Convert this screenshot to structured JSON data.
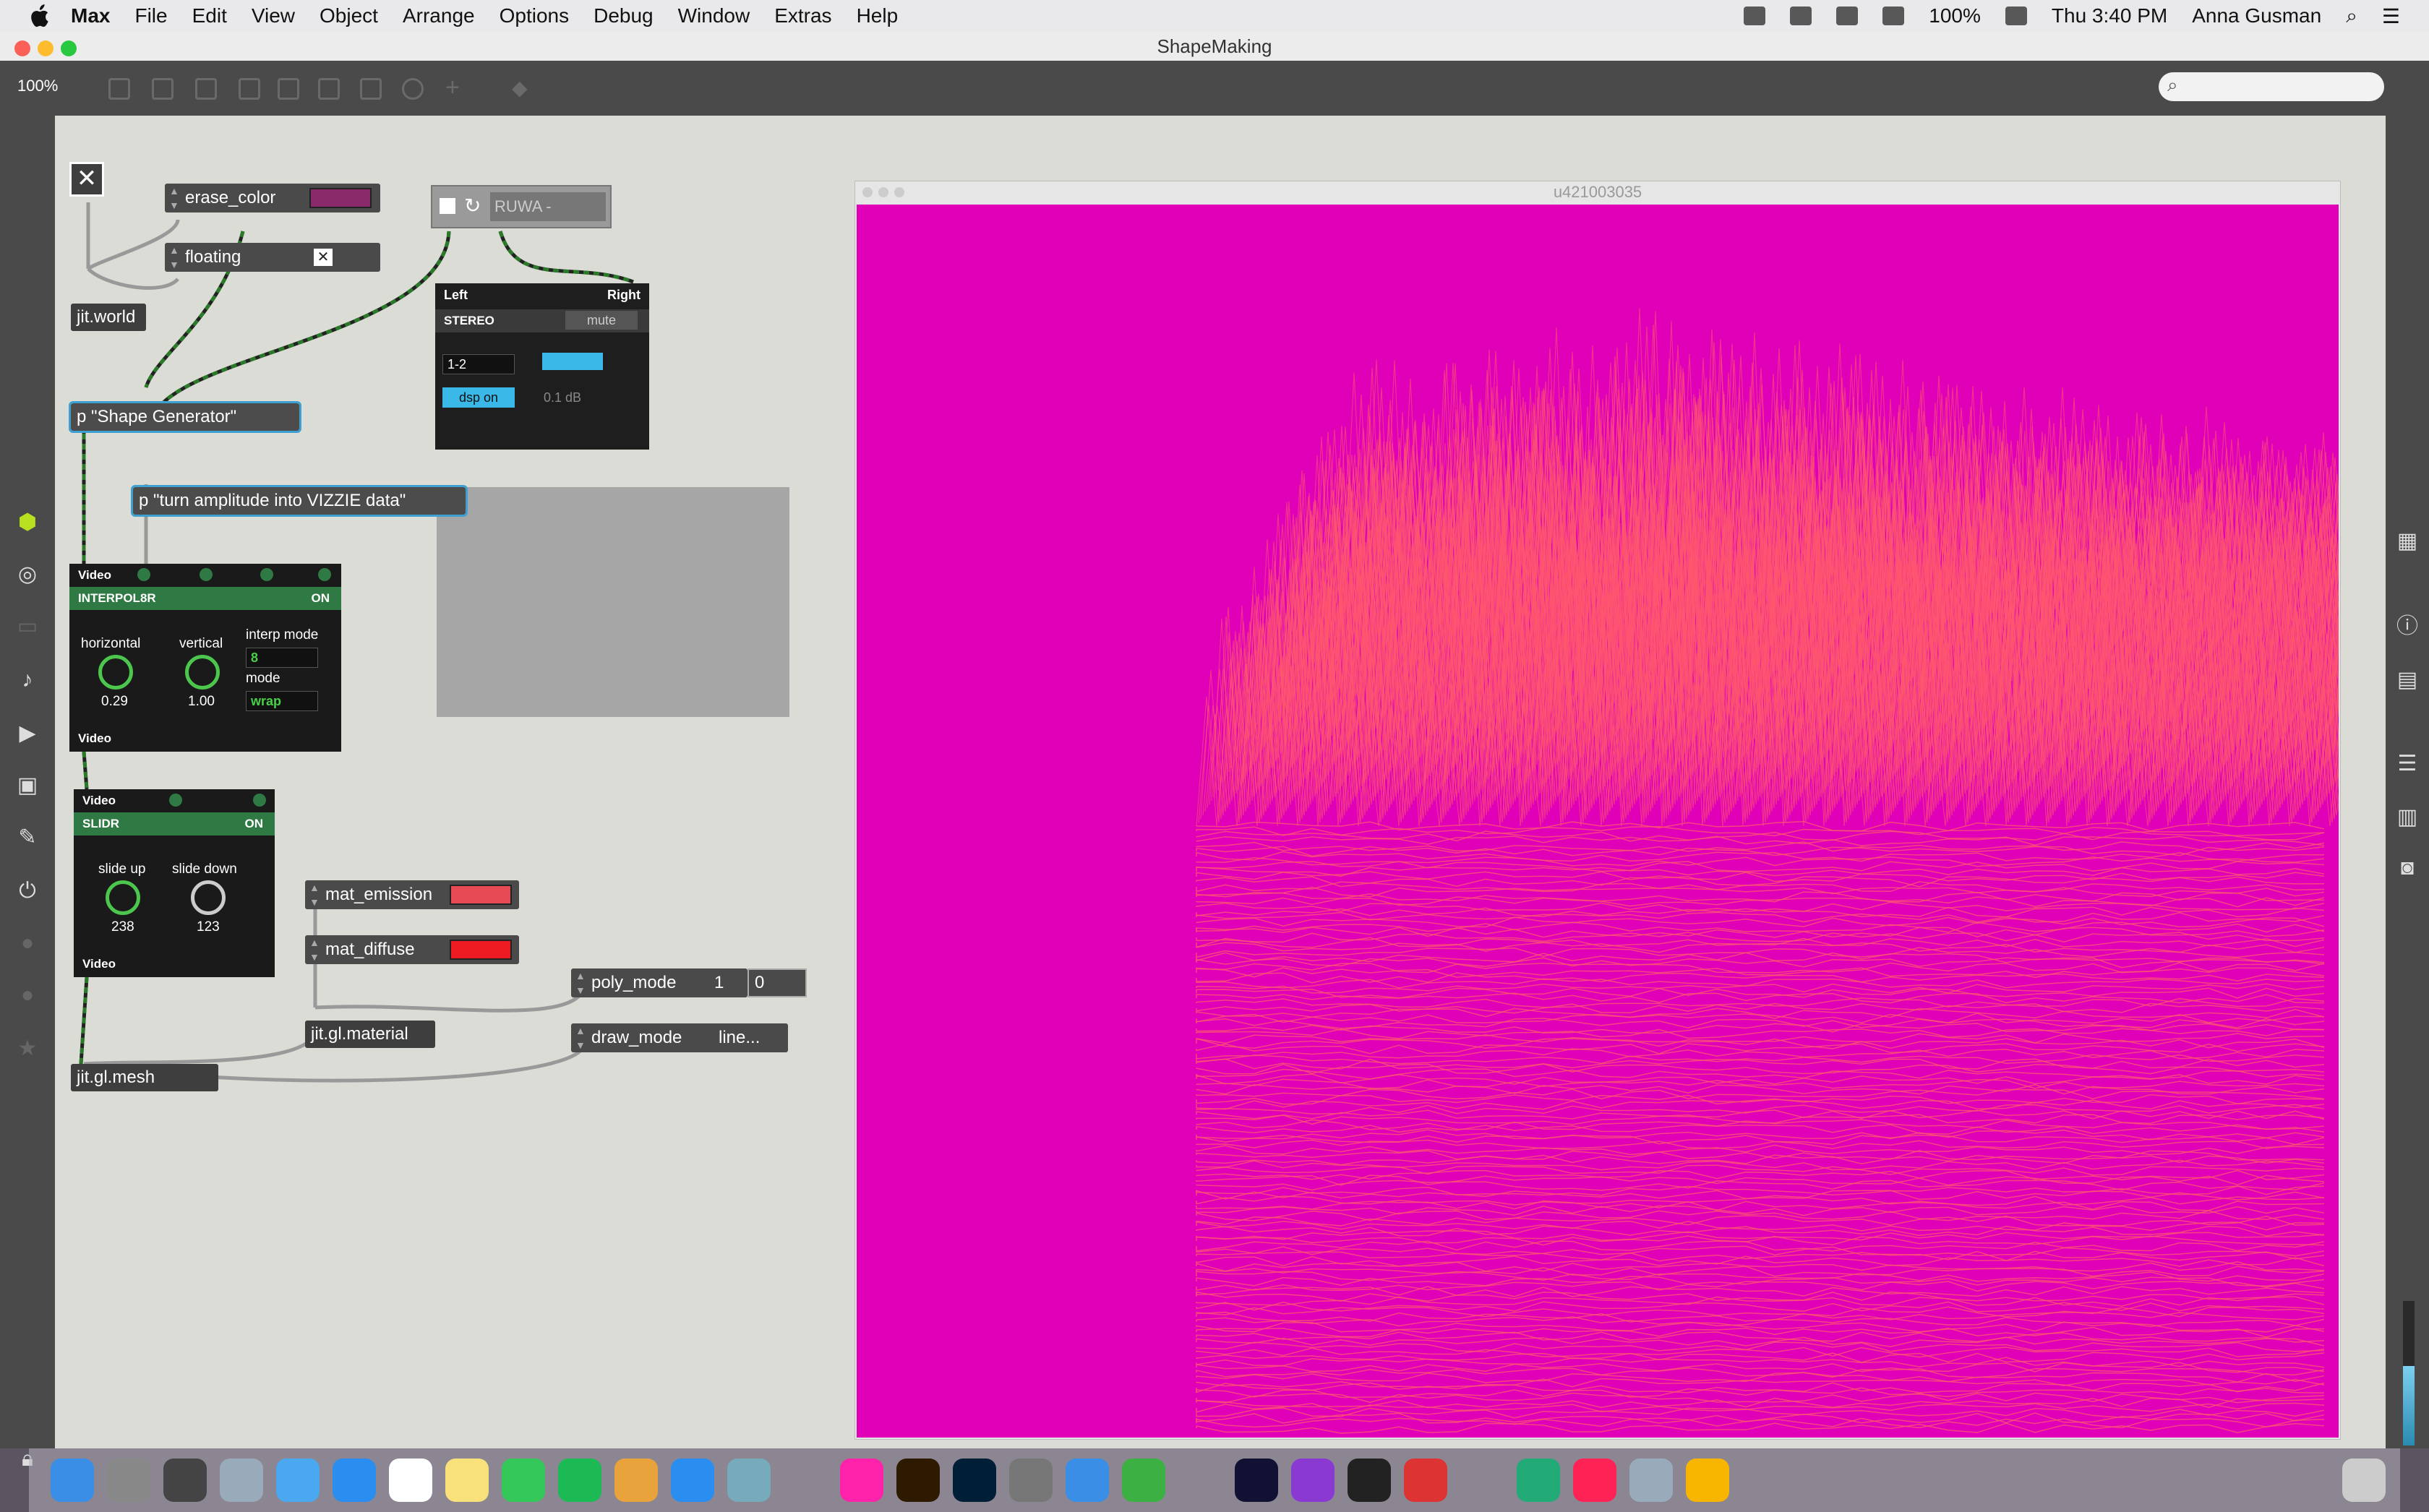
{
  "menubar": {
    "app": "Max",
    "items": [
      "File",
      "Edit",
      "View",
      "Object",
      "Arrange",
      "Options",
      "Debug",
      "Window",
      "Extras",
      "Help"
    ],
    "battery": "100%",
    "clock": "Thu 3:40 PM",
    "user": "Anna Gusman"
  },
  "window": {
    "title": "ShapeMaking",
    "zoom": "100%"
  },
  "patch": {
    "jit_world": "jit.world",
    "erase_color": "erase_color",
    "floating": "floating",
    "floating_check": "✕",
    "player_track": "RUWA - Scared ...",
    "shape_generator": "p \"Shape Generator\"",
    "turn_amp": "p \"turn amplitude into VIZZIE data\"",
    "mat_emission": "mat_emission",
    "mat_diffuse": "mat_diffuse",
    "jit_gl_material": "jit.gl.material",
    "jit_gl_mesh": "jit.gl.mesh",
    "poly_mode": "poly_mode",
    "poly_vals": [
      "1",
      "0"
    ],
    "draw_mode": "draw_mode",
    "draw_mode_val": "line...",
    "colors": {
      "erase": "#8a2a6a",
      "emission": "#e84a55",
      "diffuse": "#ee1a22"
    }
  },
  "audio": {
    "left": "Left",
    "right": "Right",
    "stereo": "STEREO",
    "mute": "mute",
    "channels": "1-2",
    "dsp": "dsp on",
    "gain": "0.1 dB"
  },
  "interpolator": {
    "top": "Video",
    "name": "INTERPOL8R",
    "state": "ON",
    "h_label": "horizontal",
    "h_val": "0.29",
    "v_label": "vertical",
    "v_val": "1.00",
    "interp_label": "interp mode",
    "interp_val": "8",
    "mode_label": "mode",
    "mode_val": "wrap",
    "bottom": "Video"
  },
  "slidr": {
    "top": "Video",
    "name": "SLIDR",
    "state": "ON",
    "up_label": "slide up",
    "up_val": "238",
    "down_label": "slide down",
    "down_val": "123",
    "bottom": "Video"
  },
  "render": {
    "title": "u421003035",
    "bg": "#e000b8",
    "fg": "#ff5a6e"
  }
}
